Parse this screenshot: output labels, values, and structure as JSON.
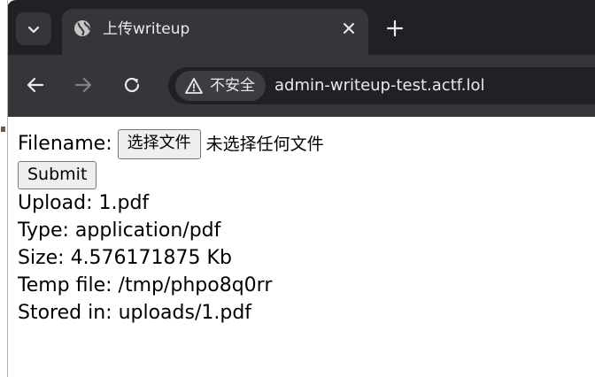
{
  "browser": {
    "tab": {
      "title": "上传writeup",
      "favicon": "globe-icon"
    },
    "toolbar": {
      "security_label": "不安全",
      "url": "admin-writeup-test.actf.lol"
    },
    "colors": {
      "frame": "#202124",
      "toolbar": "#35363a",
      "text": "#e8eaed"
    }
  },
  "page": {
    "form": {
      "filename_label": "Filename:",
      "choose_button": "选择文件",
      "file_status": "未选择任何文件",
      "submit_label": "Submit"
    },
    "result": {
      "upload": "Upload: 1.pdf",
      "type": "Type: application/pdf",
      "size": "Size: 4.576171875 Kb",
      "temp": "Temp file: /tmp/phpo8q0rr",
      "stored": "Stored in: uploads/1.pdf"
    }
  }
}
